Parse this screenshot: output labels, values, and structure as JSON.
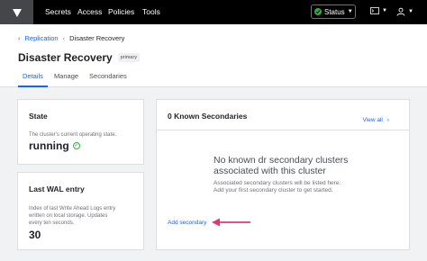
{
  "nav": {
    "links": [
      "Secrets",
      "Access",
      "Policies",
      "Tools"
    ],
    "status_label": "Status",
    "terminal_icon": "terminal-icon",
    "user_icon": "user-icon"
  },
  "breadcrumb": {
    "parent": "Replication",
    "current": "Disaster Recovery"
  },
  "page": {
    "title": "Disaster Recovery",
    "badge": "primary"
  },
  "tabs": [
    "Details",
    "Manage",
    "Secondaries"
  ],
  "state_card": {
    "title": "State",
    "description": "The cluster's current operating state.",
    "value": "running"
  },
  "wal_card": {
    "title": "Last WAL entry",
    "description_lines": [
      "Index of last Write Ahead Logs entry",
      "written on local storage. Updates",
      "every ten seconds."
    ],
    "value": "30"
  },
  "secondaries_card": {
    "title": "0 Known Secondaries",
    "view_all": "View all",
    "empty_title_lines": [
      "No known dr secondary clusters",
      "associated with this cluster"
    ],
    "empty_body_lines": [
      "Associated secondary clusters will be listed here.",
      "Add your first secondary cluster to get started."
    ],
    "add_link": "Add secondary"
  },
  "colors": {
    "accent": "#1563ff",
    "success": "#2eb039",
    "annotation_arrow": "#e03875"
  }
}
